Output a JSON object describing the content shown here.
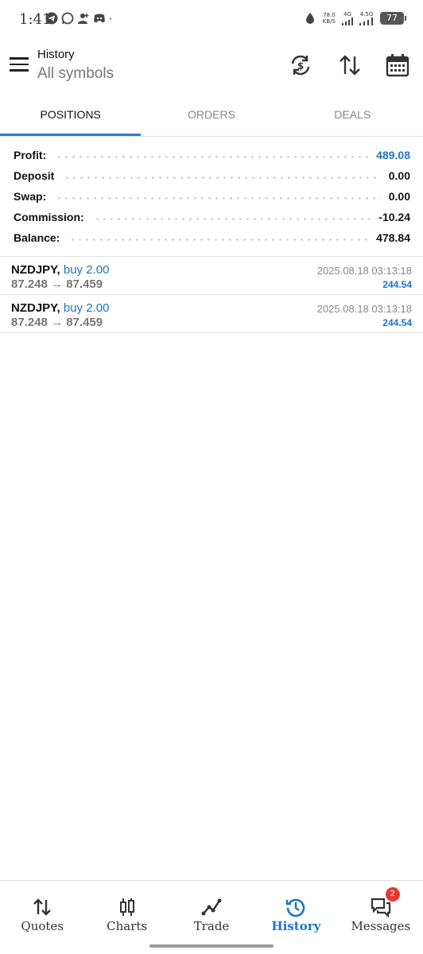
{
  "status_bar": {
    "time": "1:41",
    "net_speed_value": "78.0",
    "net_speed_unit": "KB/S",
    "signal_1_label": "4G",
    "signal_2_label": "4.5G",
    "battery": "77"
  },
  "header": {
    "title": "History",
    "subtitle": "All symbols"
  },
  "tabs": [
    {
      "label": "POSITIONS",
      "active": true
    },
    {
      "label": "ORDERS",
      "active": false
    },
    {
      "label": "DEALS",
      "active": false
    }
  ],
  "summary": [
    {
      "label": "Profit:",
      "value": "489.08"
    },
    {
      "label": "Deposit",
      "value": "0.00"
    },
    {
      "label": "Swap:",
      "value": "0.00"
    },
    {
      "label": "Commission:",
      "value": "-10.24"
    },
    {
      "label": "Balance:",
      "value": "478.84"
    }
  ],
  "deals": [
    {
      "symbol": "NZDJPY,",
      "type": "buy 2.00",
      "prices": "87.248 → 87.459",
      "time": "2025.08.18 03:13:18",
      "profit": "244.54"
    },
    {
      "symbol": "NZDJPY,",
      "type": "buy 2.00",
      "prices": "87.248 → 87.459",
      "time": "2025.08.18 03:13:18",
      "profit": "244.54"
    }
  ],
  "bottom_nav": [
    {
      "label": "Quotes",
      "icon": "quotes-icon"
    },
    {
      "label": "Charts",
      "icon": "charts-icon"
    },
    {
      "label": "Trade",
      "icon": "trade-icon"
    },
    {
      "label": "History",
      "icon": "history-icon",
      "active": true
    },
    {
      "label": "Messages",
      "icon": "messages-icon",
      "badge": "2"
    }
  ],
  "colors": {
    "accent": "#1f74c8",
    "badge": "#e53935"
  }
}
